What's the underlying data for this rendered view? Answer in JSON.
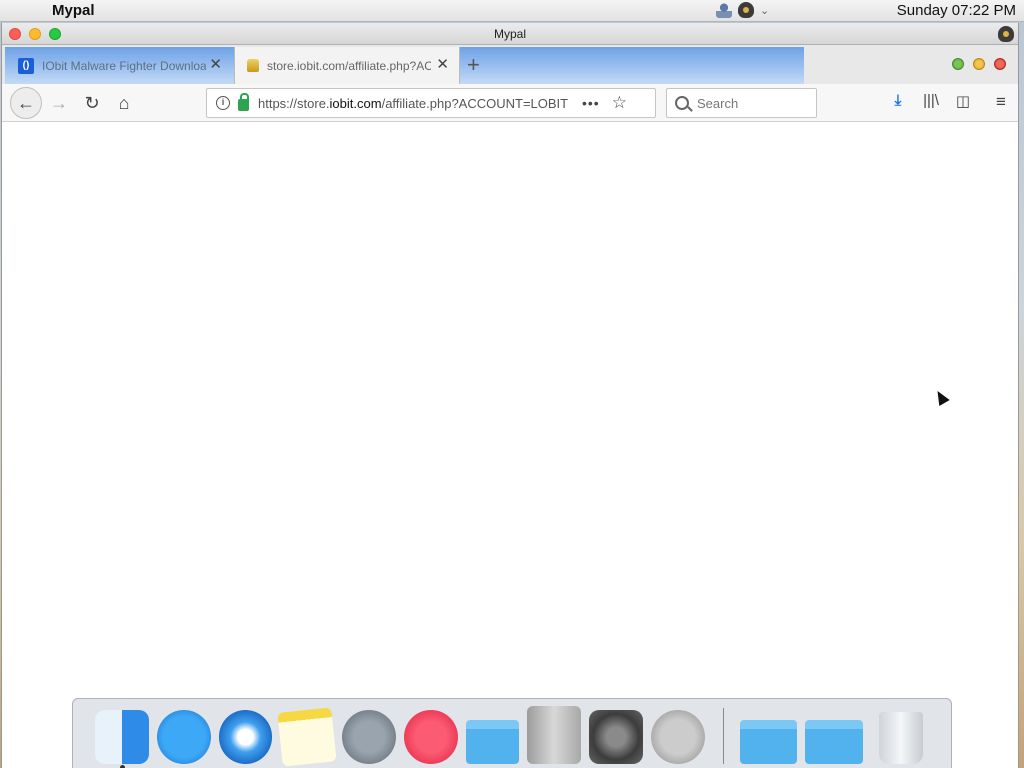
{
  "menubar": {
    "app_name": "Mypal",
    "clock": "Sunday 07:22 PM",
    "tray_icons": [
      "user-icon",
      "eye-icon",
      "chevron-down-icon"
    ]
  },
  "window": {
    "title": "Mypal"
  },
  "tabs": [
    {
      "label": "IObit Malware Fighter Download",
      "favicon": "iobit-icon",
      "active": false
    },
    {
      "label": "store.iobit.com/affiliate.php?AC",
      "favicon": "lock-icon",
      "active": true
    }
  ],
  "navbar": {
    "url_prefix": "https://store.",
    "url_domain": "iobit.com",
    "url_suffix": "/affiliate.php?ACCOUNT=LOBIT",
    "search_placeholder": "Search"
  },
  "dock": {
    "items": [
      "finder-icon",
      "app-store-icon",
      "safari-icon",
      "notes-icon",
      "launchpad-icon",
      "itunes-icon",
      "applications-folder-icon",
      "mac-pro-icon",
      "system-preferences-icon",
      "power-icon",
      "documents-folder-icon",
      "downloads-folder-icon",
      "trash-icon"
    ]
  },
  "colors": {
    "accent": "#1a73e8",
    "tab_strip": "#6ea2e6",
    "secure_lock": "#2ea44f"
  }
}
